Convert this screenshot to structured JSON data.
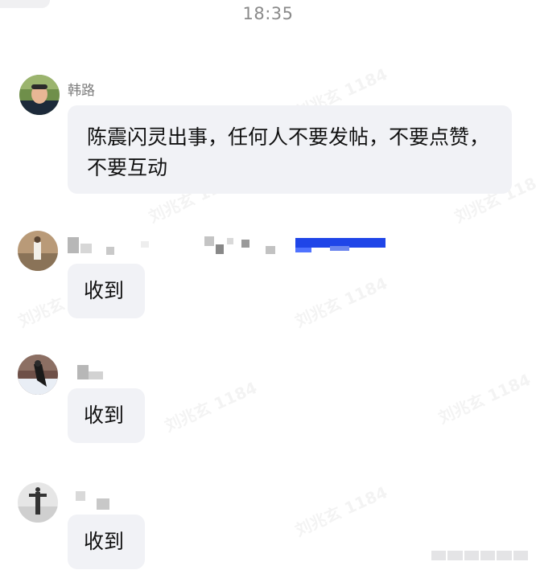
{
  "status": {
    "time": "18:35"
  },
  "messages": [
    {
      "sender": "韩路",
      "text": "陈震闪灵出事，任何人不要发帖，不要点赞，不要互动"
    },
    {
      "sender": "",
      "text": "收到"
    },
    {
      "sender": "",
      "text": "收到"
    },
    {
      "sender": "",
      "text": "收到"
    }
  ],
  "watermark": {
    "text": "刘兆玄 1184"
  },
  "colors": {
    "bubble": "#f1f2f6",
    "timestamp": "#8a8a8a",
    "sender": "#7d7d7d",
    "accent_redaction": "#1f45e8"
  }
}
